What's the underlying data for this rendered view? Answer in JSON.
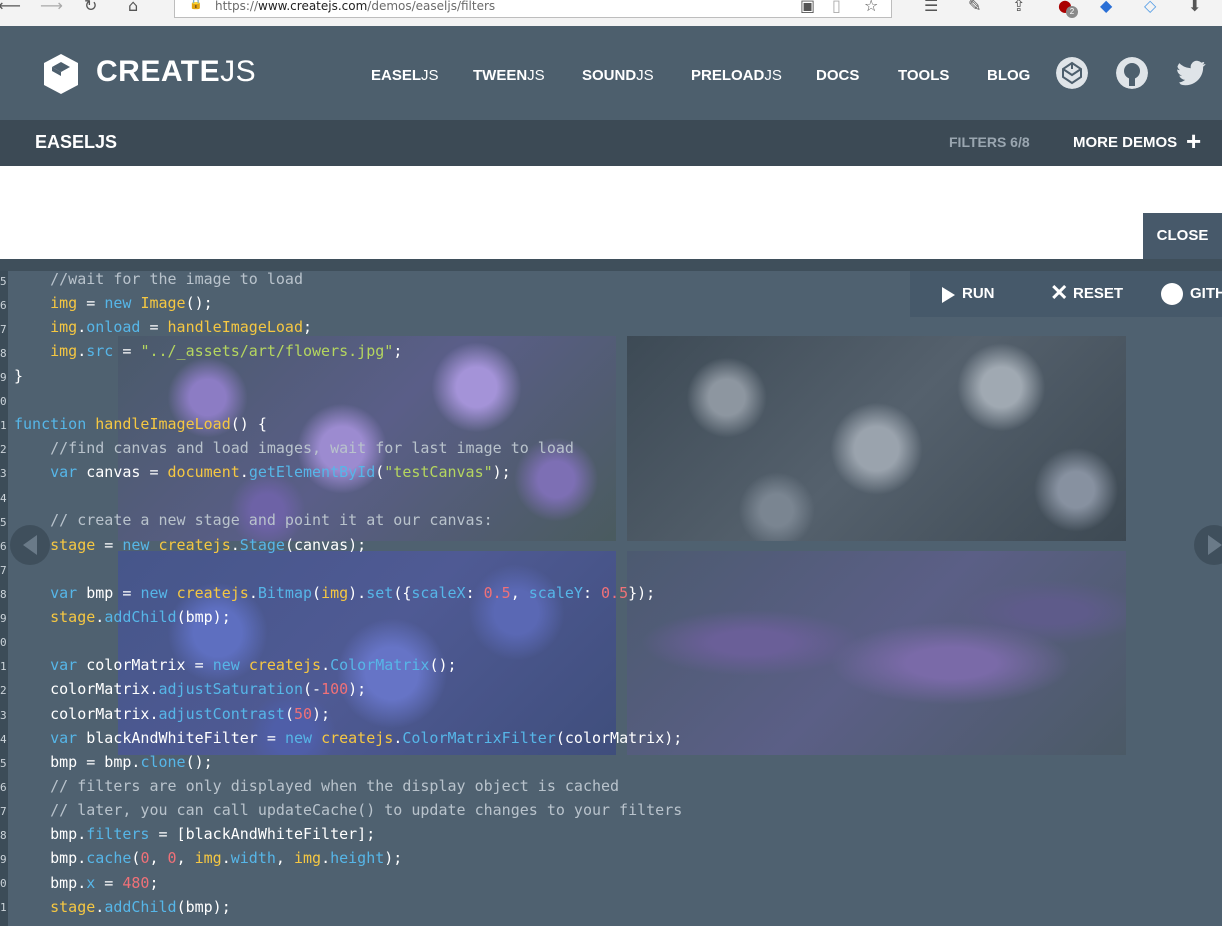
{
  "browser": {
    "url_prefix": "https://",
    "url_host": "www.createjs.com",
    "url_path": "/demos/easeljs/filters",
    "badge_count": "2"
  },
  "header": {
    "logo_bold": "CREATE",
    "logo_light": "JS",
    "nav": [
      {
        "bold": "EASEL",
        "light": "JS"
      },
      {
        "bold": "TWEEN",
        "light": "JS"
      },
      {
        "bold": "SOUND",
        "light": "JS"
      },
      {
        "bold": "PRELOAD",
        "light": "JS"
      },
      {
        "bold": "DOCS",
        "light": ""
      },
      {
        "bold": "TOOLS",
        "light": ""
      },
      {
        "bold": "BLOG",
        "light": ""
      }
    ]
  },
  "subheader": {
    "title": "EASELJS",
    "filters_count": "FILTERS 6/8",
    "more_demos": "MORE DEMOS"
  },
  "demo": {
    "close_label": "CLOSE",
    "run_label": "RUN",
    "reset_label": "RESET",
    "github_label": "GITH",
    "gutter_numbers": [
      "5",
      "6",
      "7",
      "8",
      "9",
      "0",
      "1",
      "2",
      "3",
      "4",
      "5",
      "6",
      "7",
      "8",
      "9",
      "0",
      "1",
      "2",
      "3",
      "4",
      "5",
      "6",
      "7",
      "8",
      "9",
      "0",
      "1"
    ]
  },
  "colors": {
    "header_bg": "#4d5f6d",
    "subheader_bg": "#3c4a55",
    "demo_bg": "#4f6170",
    "keyword": "#56b6e8",
    "function": "#f5c742",
    "string": "#b5d65f",
    "number": "#f07178"
  }
}
